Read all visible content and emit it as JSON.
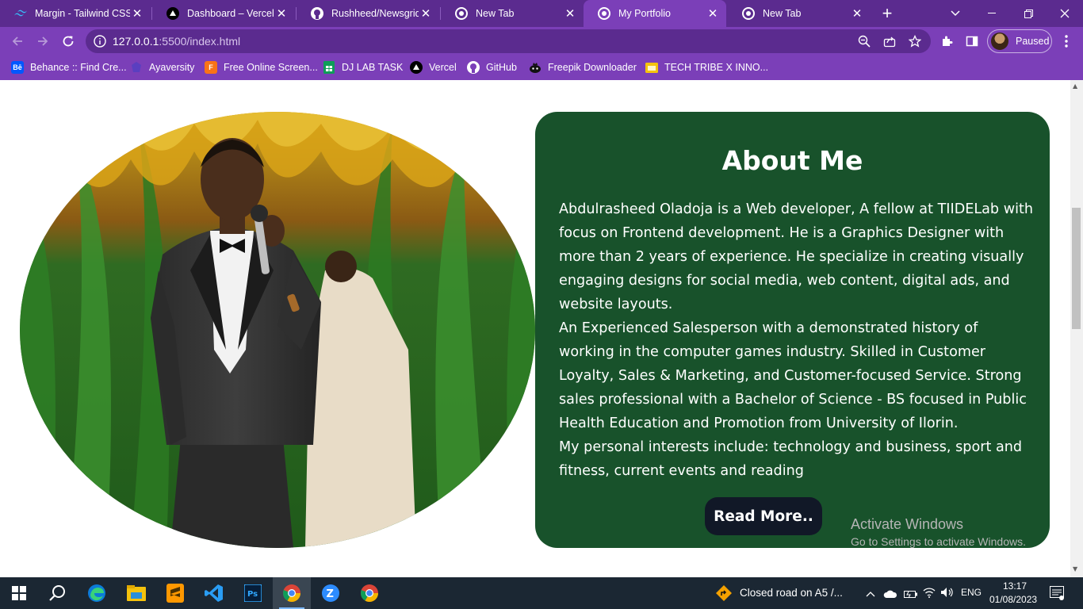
{
  "browser": {
    "tabs": [
      {
        "title": "Margin - Tailwind CSS",
        "icon": "tailwind-icon",
        "active": false
      },
      {
        "title": "Dashboard – Vercel",
        "icon": "vercel-icon",
        "active": false
      },
      {
        "title": "Rushheed/Newsgrid",
        "icon": "github-icon",
        "active": false
      },
      {
        "title": "New Tab",
        "icon": "chrome-icon",
        "active": false
      },
      {
        "title": "My Portfolio",
        "icon": "chrome-icon",
        "active": true
      },
      {
        "title": "New Tab",
        "icon": "chrome-icon",
        "active": false
      }
    ],
    "url_host": "127.0.0.1",
    "url_rest": ":5500/index.html",
    "profile_label": "Paused",
    "bookmarks": [
      {
        "label": "Behance :: Find Cre...",
        "icon": "behance-icon",
        "badge": "Bē"
      },
      {
        "label": "Ayaversity",
        "icon": "ayaversity-icon",
        "badge": ""
      },
      {
        "label": "Free Online Screen...",
        "icon": "screen-recorder-icon",
        "badge": "F"
      },
      {
        "label": "DJ LAB TASK",
        "icon": "google-sheets-icon",
        "badge": ""
      },
      {
        "label": "Vercel",
        "icon": "vercel-icon",
        "badge": ""
      },
      {
        "label": "GitHub",
        "icon": "github-icon",
        "badge": ""
      },
      {
        "label": "Freepik Downloader",
        "icon": "freepik-icon",
        "badge": ""
      },
      {
        "label": "TECH TRIBE X INNO...",
        "icon": "folder-icon",
        "badge": ""
      }
    ],
    "accent_colors": {
      "tabbar": "#5b2b8f",
      "toolbar": "#7b3fb8"
    }
  },
  "page": {
    "about_title": "About Me",
    "about_paragraphs": [
      "Abdulrasheed Oladoja is a Web developer, A fellow at TIIDELab with focus on Frontend development. He is a Graphics Designer with more than 2 years of experience. He specialize in creating visually engaging designs for social media, web content, digital ads, and website layouts.",
      "An Experienced Salesperson with a demonstrated history of working in the computer games industry. Skilled in Customer Loyalty, Sales & Marketing, and Customer-focused Service. Strong sales professional with a Bachelor of Science - BS focused in Public Health Education and Promotion from University of Ilorin.",
      "My personal interests include: technology and business, sport and fitness, current events and reading"
    ],
    "read_more_label": "Read More..",
    "card_color": "#18522b",
    "button_color": "#111827"
  },
  "windows_watermark": {
    "line1": "Activate Windows",
    "line2": "Go to Settings to activate Windows."
  },
  "taskbar": {
    "apps": [
      "windows-start-icon",
      "search-icon",
      "edge-icon",
      "file-explorer-icon",
      "sublime-text-icon",
      "vscode-icon",
      "photoshop-icon",
      "chrome-icon",
      "zoom-icon",
      "chrome-icon"
    ],
    "notification_text": "Closed road on A5 /...",
    "language": "ENG",
    "time": "13:17",
    "date": "01/08/2023"
  }
}
